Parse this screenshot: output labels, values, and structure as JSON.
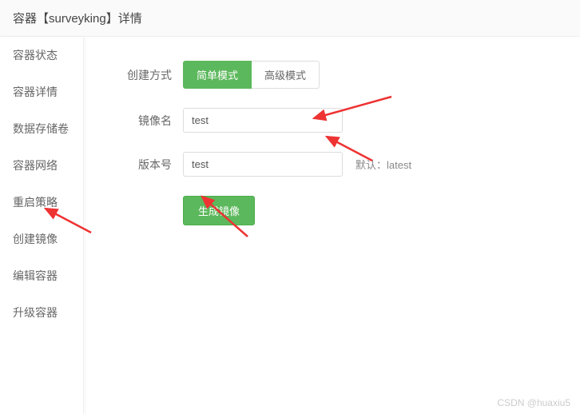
{
  "header": {
    "title": "容器【surveyking】详情"
  },
  "sidebar": {
    "items": [
      {
        "label": "容器状态"
      },
      {
        "label": "容器详情"
      },
      {
        "label": "数据存储卷"
      },
      {
        "label": "容器网络"
      },
      {
        "label": "重启策略"
      },
      {
        "label": "创建镜像"
      },
      {
        "label": "编辑容器"
      },
      {
        "label": "升级容器"
      }
    ]
  },
  "form": {
    "create_mode_label": "创建方式",
    "mode_simple": "简单模式",
    "mode_advanced": "高级模式",
    "image_name_label": "镜像名",
    "image_name_value": "test",
    "version_label": "版本号",
    "version_value": "test",
    "version_hint": "默认：latest",
    "submit_label": "生成镜像"
  },
  "watermark": "CSDN @huaxiu5"
}
